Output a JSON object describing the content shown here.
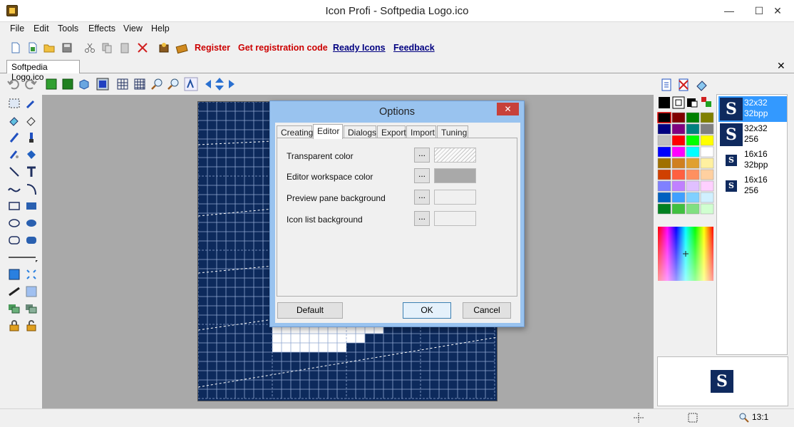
{
  "window": {
    "title": "Icon Profi - Softpedia Logo.ico",
    "minimize": "—",
    "maximize": "☐",
    "close": "✕"
  },
  "menu": [
    "File",
    "Edit",
    "Tools",
    "Effects",
    "View",
    "Help"
  ],
  "toolbar": {
    "links": [
      "Register",
      "Get registration code",
      "Ready Icons",
      "Feedback"
    ]
  },
  "document": {
    "tab_label": "Softpedia Logo.ico",
    "close": "✕"
  },
  "icon_list": [
    {
      "size": "32x32",
      "depth": "32bpp"
    },
    {
      "size": "32x32",
      "depth": "256"
    },
    {
      "size": "16x16",
      "depth": "32bpp"
    },
    {
      "size": "16x16",
      "depth": "256"
    }
  ],
  "preview": {
    "glyph": "S"
  },
  "status": {
    "zoom": "13:1"
  },
  "palette_colors": [
    "#000000",
    "#800000",
    "#008000",
    "#808000",
    "#000080",
    "#800080",
    "#008080",
    "#808080",
    "#c0c0c0",
    "#ff0000",
    "#00ff00",
    "#ffff00",
    "#0000ff",
    "#ff00ff",
    "#00ffff",
    "#ffffff",
    "#a07000",
    "#d08020",
    "#e0a030",
    "#fff0a0",
    "#d04000",
    "#ff6040",
    "#ff9060",
    "#ffd0a0",
    "#8080ff",
    "#c080ff",
    "#e0c0ff",
    "#ffd0ff",
    "#0060c0",
    "#40a0ff",
    "#80d0ff",
    "#d0f0ff",
    "#008020",
    "#40c040",
    "#80e080",
    "#d0ffd0"
  ],
  "dialog": {
    "title": "Options",
    "close": "✕",
    "tabs": [
      "Creating",
      "Editor",
      "Dialogs",
      "Export",
      "Import",
      "Tuning"
    ],
    "active_tab": "Editor",
    "options": [
      {
        "label": "Transparent color",
        "button": "..."
      },
      {
        "label": "Editor workspace color",
        "button": "..."
      },
      {
        "label": "Preview pane background",
        "button": "..."
      },
      {
        "label": "Icon list background",
        "button": "..."
      }
    ],
    "buttons": {
      "default": "Default",
      "ok": "OK",
      "cancel": "Cancel"
    }
  }
}
